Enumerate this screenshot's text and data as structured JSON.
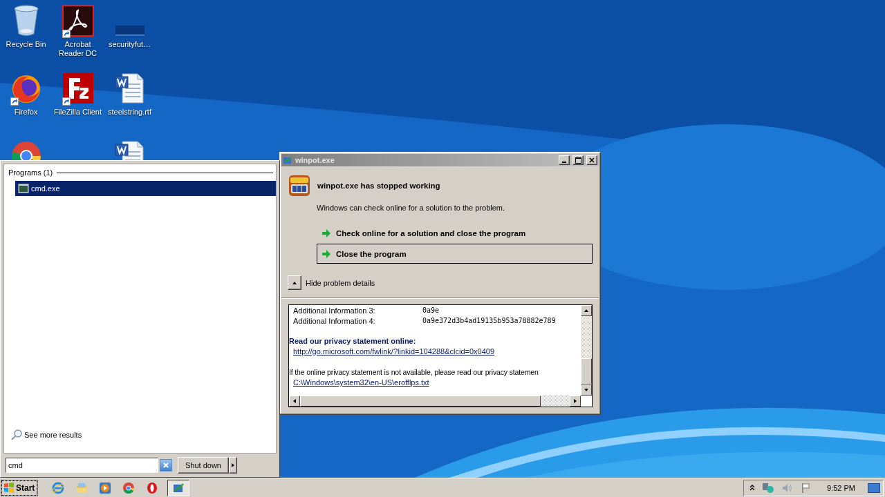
{
  "desktop": {
    "columns": [
      [
        {
          "label": "Recycle Bin",
          "kind": "recycle"
        },
        {
          "label": "Firefox",
          "kind": "firefox",
          "shortcut": true
        },
        {
          "kind": "chrome"
        }
      ],
      [
        {
          "label": "Acrobat Reader DC",
          "kind": "acrobat",
          "shortcut": true
        },
        {
          "label": "FileZilla Client",
          "kind": "filezilla",
          "shortcut": true
        }
      ],
      [
        {
          "label": "securityfut…",
          "kind": "blank"
        },
        {
          "label": "steelstring.rtf",
          "kind": "word"
        },
        {
          "kind": "word"
        }
      ]
    ]
  },
  "dialog": {
    "title": "winpot.exe",
    "heading": "winpot.exe has stopped working",
    "message": "Windows can check online for a solution to the problem.",
    "options": [
      {
        "label": "Check online for a solution and close the program",
        "selected": false
      },
      {
        "label": "Close the program",
        "selected": true
      }
    ],
    "details_toggle": {
      "label": "Hide problem details",
      "expanded": true
    },
    "details": [
      {
        "kind": "pair",
        "label": "Additional Information 3:",
        "value": "0a9e"
      },
      {
        "kind": "pair",
        "label": "Additional Information 4:",
        "value": "0a9e372d3b4ad19135b953a78882e789"
      },
      {
        "kind": "gap"
      },
      {
        "kind": "heading",
        "text": "Read our privacy statement online:"
      },
      {
        "kind": "link",
        "text": "http://go.microsoft.com/fwlink/?linkid=104288&clcid=0x0409"
      },
      {
        "kind": "gap"
      },
      {
        "kind": "text",
        "text": "If the online privacy statement is not available, please read our privacy statemen"
      },
      {
        "kind": "link",
        "text": "C:\\Windows\\system32\\en-US\\erofflps.txt"
      }
    ]
  },
  "start_menu": {
    "group": "Programs (1)",
    "results": [
      {
        "label": "cmd.exe",
        "selected": true
      }
    ],
    "see_more": "See more results",
    "search": {
      "value": "cmd"
    },
    "shutdown": "Shut down"
  },
  "taskbar": {
    "start": "Start",
    "quick_launch": [
      {
        "kind": "ie"
      },
      {
        "kind": "explorer"
      },
      {
        "kind": "media"
      },
      {
        "kind": "chrome"
      },
      {
        "kind": "opera"
      }
    ],
    "tasks": [
      {
        "kind": "winpot",
        "selected": true
      }
    ],
    "clock": "9:52 PM"
  }
}
